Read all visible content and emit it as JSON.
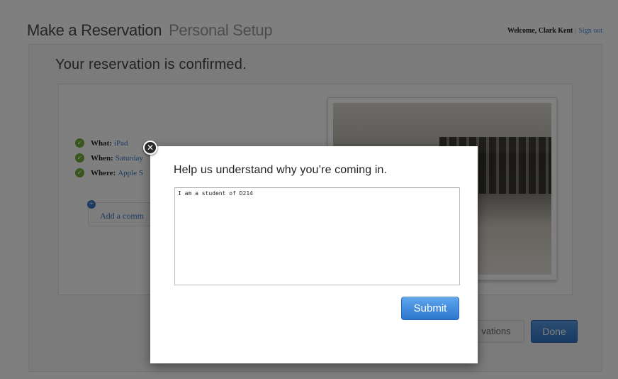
{
  "header": {
    "title": "Make a Reservation",
    "subtitle": "Personal Setup",
    "welcome_text": "Welcome, Clark Kent",
    "sign_out": "Sign out"
  },
  "confirmation": {
    "title": "Your reservation is confirmed.",
    "details": [
      {
        "label": "What:",
        "value": "iPad"
      },
      {
        "label": "When:",
        "value": "Saturday"
      },
      {
        "label": "Where:",
        "value": "Apple S"
      }
    ],
    "add_comment": "Add a comm"
  },
  "footer": {
    "my_reservations": "vations",
    "done": "Done"
  },
  "modal": {
    "heading": "Help us understand why you’re coming in.",
    "comment_value": "I am a student of D214",
    "submit": "Submit",
    "close_icon": "close-x-icon"
  },
  "colors": {
    "accent": "#2d76cf",
    "check": "#6fae3c",
    "overlay": "rgba(0,0,0,0.5)"
  }
}
